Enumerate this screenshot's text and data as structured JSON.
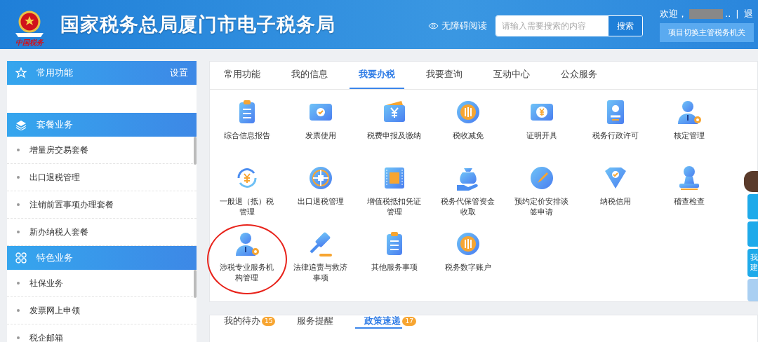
{
  "header": {
    "logo_text": "中国税务",
    "title": "国家税务总局厦门市电子税务局",
    "accessibility": "无障碍阅读",
    "search": {
      "placeholder": "请输入需要搜索的内容",
      "button": "搜索"
    },
    "welcome": "欢迎，",
    "welcome_tail": "..",
    "separator": "|",
    "logout": "退",
    "switch_button": "项目切换主管税务机关"
  },
  "sidebar": {
    "sections": [
      {
        "title": "常用功能",
        "action": "设置"
      },
      {
        "title": "套餐业务",
        "items": [
          "增量房交易套餐",
          "出口退税管理",
          "注销前置事项办理套餐",
          "新办纳税人套餐"
        ]
      },
      {
        "title": "特色业务",
        "items": [
          "社保业务",
          "发票网上申领",
          "税企邮箱"
        ]
      }
    ]
  },
  "main": {
    "tabs": [
      {
        "label": "常用功能",
        "selected": false
      },
      {
        "label": "我的信息",
        "selected": false
      },
      {
        "label": "我要办税",
        "selected": true
      },
      {
        "label": "我要查询",
        "selected": false
      },
      {
        "label": "互动中心",
        "selected": false
      },
      {
        "label": "公众服务",
        "selected": false
      }
    ],
    "services": [
      {
        "label": "综合信息报告",
        "kind": "clipboard",
        "highlighted": false
      },
      {
        "label": "发票使用",
        "kind": "ticket-check",
        "highlighted": false
      },
      {
        "label": "税费申报及缴纳",
        "kind": "wallet",
        "highlighted": false
      },
      {
        "label": "税收减免",
        "kind": "coin",
        "highlighted": false
      },
      {
        "label": "证明开具",
        "kind": "ticket-yen",
        "highlighted": false
      },
      {
        "label": "税务行政许可",
        "kind": "id-card",
        "highlighted": false
      },
      {
        "label": "核定管理",
        "kind": "person-gear",
        "highlighted": false
      },
      {
        "label": "一般退（抵）税管理",
        "kind": "cycle",
        "highlighted": false
      },
      {
        "label": "出口退税管理",
        "kind": "globe",
        "highlighted": false
      },
      {
        "label": "增值税抵扣凭证管理",
        "kind": "ticket",
        "highlighted": false
      },
      {
        "label": "税务代保管资金收取",
        "kind": "bag",
        "highlighted": false
      },
      {
        "label": "预约定价安排谈签申请",
        "kind": "compass",
        "highlighted": false
      },
      {
        "label": "纳税信用",
        "kind": "shield",
        "highlighted": false
      },
      {
        "label": "稽查检查",
        "kind": "stamp",
        "highlighted": false
      },
      {
        "label": "涉税专业服务机构管理",
        "kind": "person-gear",
        "highlighted": true
      },
      {
        "label": "法律追责与救济事项",
        "kind": "gavel",
        "highlighted": false
      },
      {
        "label": "其他服务事项",
        "kind": "clipboard",
        "highlighted": false
      },
      {
        "label": "税务数字账户",
        "kind": "coin",
        "highlighted": false
      }
    ]
  },
  "bottom": {
    "tabs": [
      {
        "label": "我的待办",
        "badge": "15",
        "selected": false
      },
      {
        "label": "服务提醒",
        "selected": false
      },
      {
        "label": "政策速递",
        "badge": "17",
        "selected": true
      }
    ]
  },
  "side_float": {
    "text": "我建"
  }
}
